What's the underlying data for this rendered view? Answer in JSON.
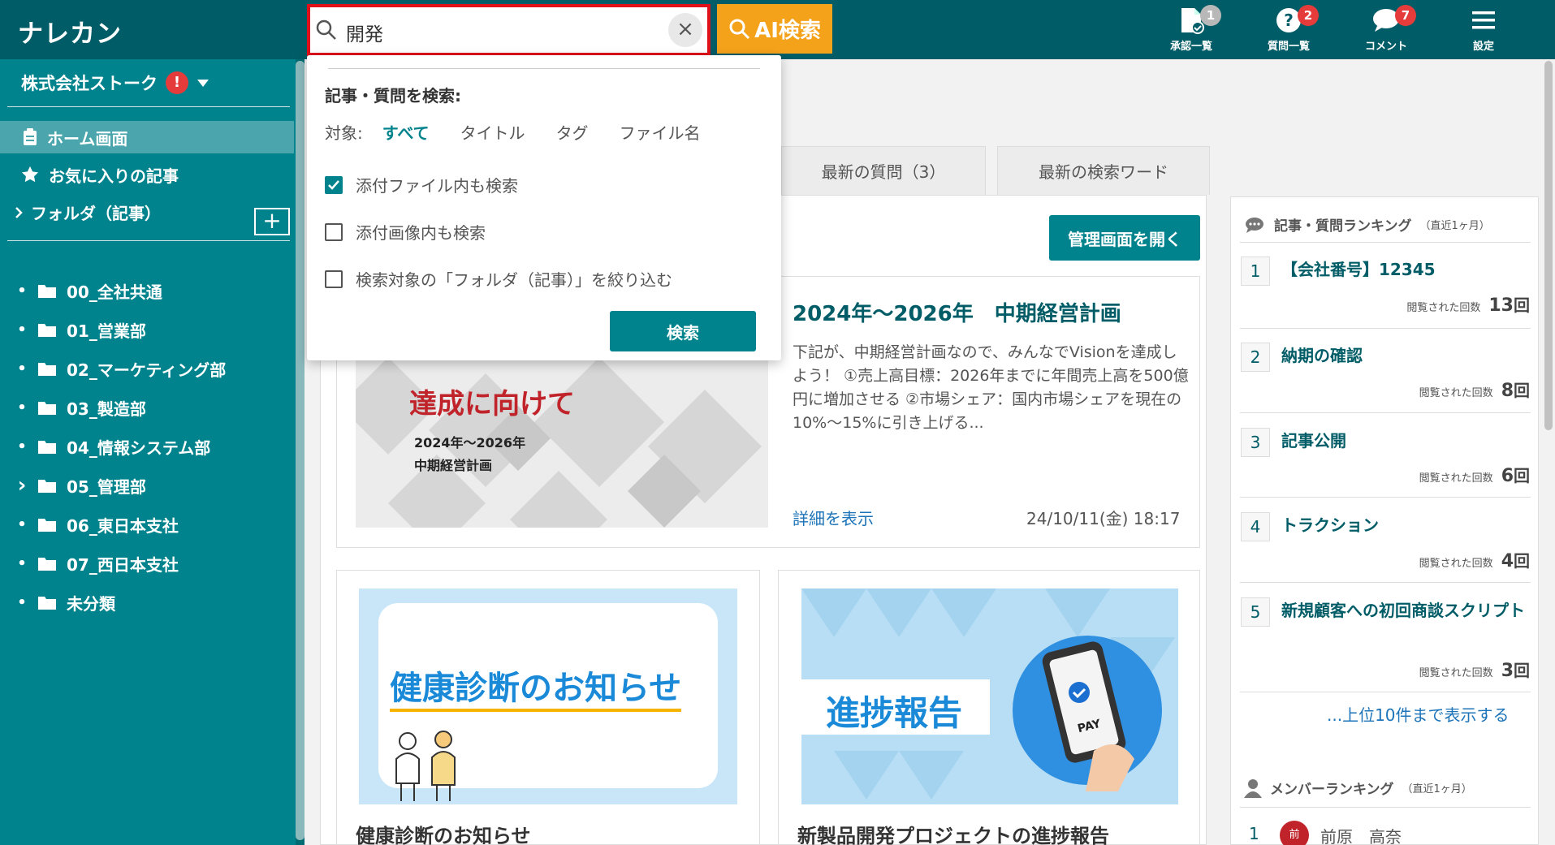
{
  "app": {
    "logo": "ナレカン"
  },
  "search": {
    "value": "開発",
    "clear": "×",
    "ai_label": "AI検索"
  },
  "header_icons": [
    {
      "label": "承認一覧",
      "badge": "1"
    },
    {
      "label": "質問一覧",
      "badge": "2"
    },
    {
      "label": "コメント",
      "badge": "7"
    },
    {
      "label": "設定"
    }
  ],
  "sidebar": {
    "company": "株式会社ストーク",
    "warning": "!",
    "home": "ホーム画面",
    "favorites": "お気に入りの記事",
    "folder_header": "フォルダ（記事）",
    "add": "+",
    "folders": [
      {
        "marker": "•",
        "name": "00_全社共通"
      },
      {
        "marker": "•",
        "name": "01_営業部"
      },
      {
        "marker": "•",
        "name": "02_マーケティング部"
      },
      {
        "marker": "•",
        "name": "03_製造部"
      },
      {
        "marker": "•",
        "name": "04_情報システム部"
      },
      {
        "marker": "›",
        "name": "05_管理部"
      },
      {
        "marker": "•",
        "name": "06_東日本支社"
      },
      {
        "marker": "•",
        "name": "07_西日本支社"
      },
      {
        "marker": "•",
        "name": "未分類"
      }
    ]
  },
  "tabs": {
    "questions": "最新の質問（3）",
    "keywords": "最新の検索ワード"
  },
  "main": {
    "admin_button": "管理画面を開く",
    "featured": {
      "title": "2024年〜2026年　中期経営計画",
      "desc": "下記が、中期経営計画なので、みんなでVisionを達成しよう！ ①売上高目標：2026年までに年間売上高を500億円に増加させる ②市場シェア：国内市場シェアを現在の10%〜15%に引き上げる...",
      "link": "詳細を表示",
      "date": "24/10/11(金) 18:17",
      "thumb_heading": "達成に向けて",
      "thumb_line1": "2024年〜2026年",
      "thumb_line2": "中期経営計画"
    },
    "cards": [
      {
        "thumb_text": "健康診断のお知らせ",
        "title": "健康診断のお知らせ"
      },
      {
        "thumb_text": "進捗報告",
        "pay": "PAY",
        "title": "新製品開発プロジェクトの進捗報告"
      }
    ]
  },
  "ranking": {
    "header": "記事・質問ランキング",
    "period": "（直近1ヶ月）",
    "views_label": "閲覧された回数",
    "unit": "回",
    "items": [
      {
        "rank": "1",
        "title": "【会社番号】12345",
        "count": "13"
      },
      {
        "rank": "2",
        "title": "納期の確認",
        "count": "8"
      },
      {
        "rank": "3",
        "title": "記事公開",
        "count": "6"
      },
      {
        "rank": "4",
        "title": "トラクション",
        "count": "4"
      },
      {
        "rank": "5",
        "title": "新規顧客への初回商談スクリプト",
        "count": "3"
      }
    ],
    "more": "...上位10件まで表示する",
    "member_header": "メンバーランキング",
    "member_period": "（直近1ヶ月）",
    "member_first": {
      "rank": "1",
      "initial": "前",
      "name": "前原　高奈"
    }
  },
  "dropdown": {
    "heading": "記事・質問を検索:",
    "target_label": "対象:",
    "targets": [
      "すべて",
      "タイトル",
      "タグ",
      "ファイル名"
    ],
    "options": [
      {
        "label": "添付ファイル内も検索",
        "checked": true
      },
      {
        "label": "添付画像内も検索",
        "checked": false
      },
      {
        "label": "検索対象の「フォルダ（記事）」を絞り込む",
        "checked": false
      }
    ],
    "search_button": "検索"
  },
  "colors": {
    "header": "#005c66",
    "sidebar": "#00838c",
    "accent": "#f5a21b",
    "alert": "#e53b3b",
    "link": "#1e74b8"
  }
}
